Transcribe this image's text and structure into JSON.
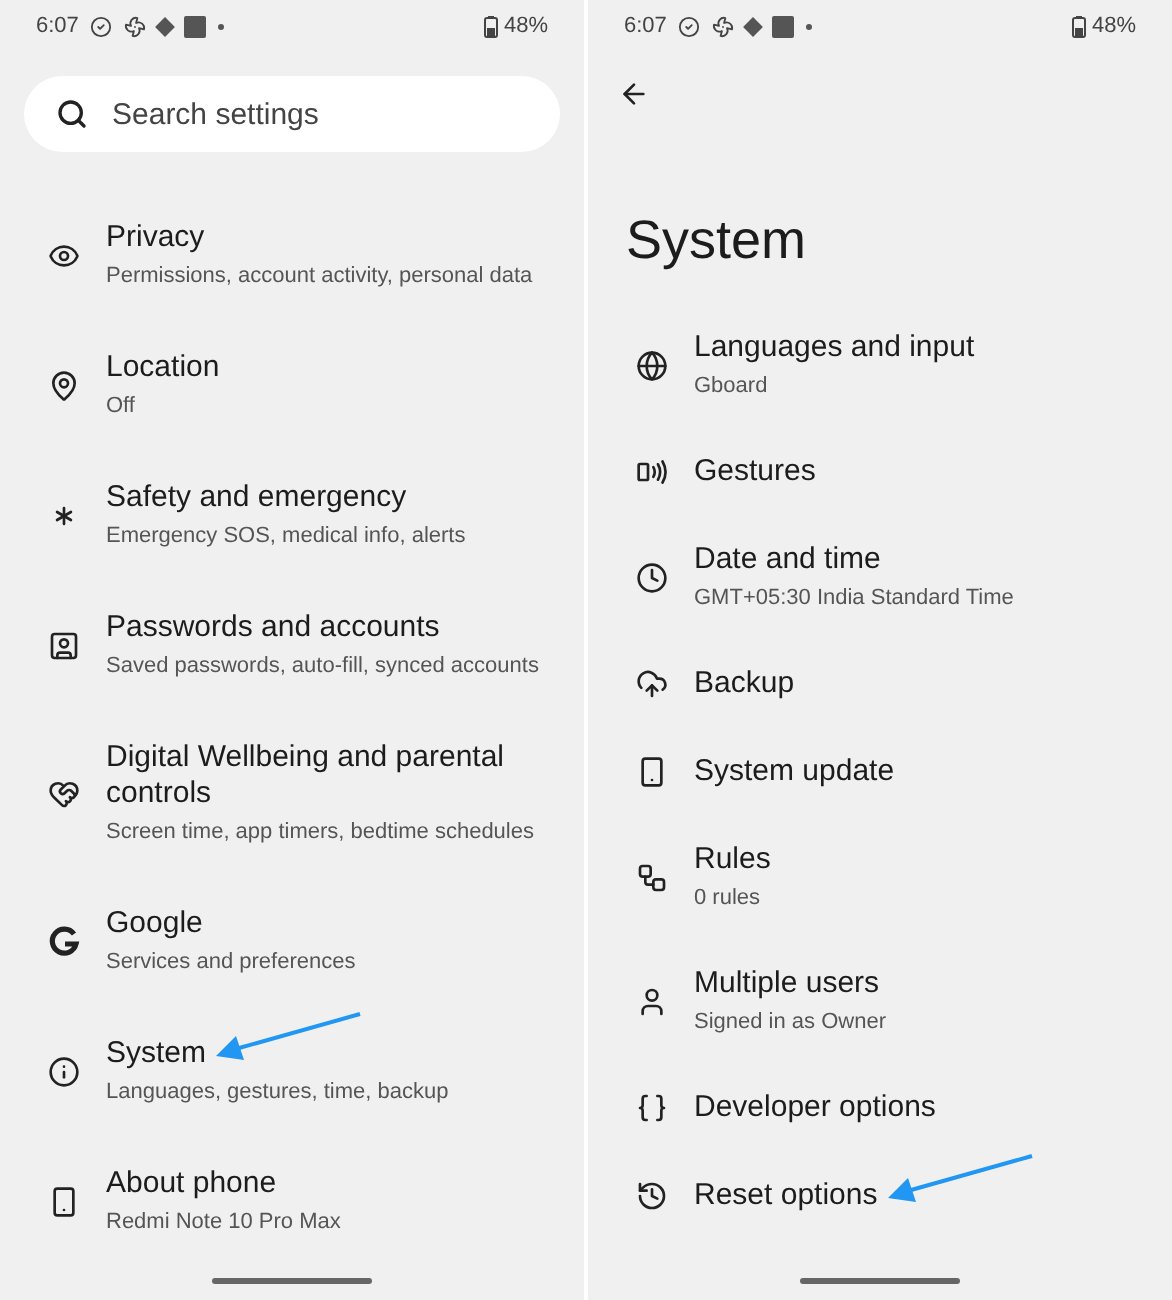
{
  "screens": [
    {
      "status_bar": {
        "time": "6:07",
        "battery": "48%"
      },
      "search": {
        "placeholder": "Search settings"
      },
      "items": [
        {
          "title": "Privacy",
          "subtitle": "Permissions, account activity, personal data",
          "annotated": false
        },
        {
          "title": "Location",
          "subtitle": "Off",
          "annotated": false
        },
        {
          "title": "Safety and emergency",
          "subtitle": "Emergency SOS, medical info, alerts",
          "annotated": false
        },
        {
          "title": "Passwords and accounts",
          "subtitle": "Saved passwords, auto-fill, synced accounts",
          "annotated": false
        },
        {
          "title": "Digital Wellbeing and parental controls",
          "subtitle": "Screen time, app timers, bedtime schedules",
          "annotated": false
        },
        {
          "title": "Google",
          "subtitle": "Services and preferences",
          "annotated": false
        },
        {
          "title": "System",
          "subtitle": "Languages, gestures, time, backup",
          "annotated": true
        },
        {
          "title": "About phone",
          "subtitle": "Redmi Note 10 Pro Max",
          "annotated": false
        }
      ]
    },
    {
      "status_bar": {
        "time": "6:07",
        "battery": "48%"
      },
      "title": "System",
      "items": [
        {
          "title": "Languages and input",
          "subtitle": "Gboard",
          "annotated": false
        },
        {
          "title": "Gestures",
          "annotated": false
        },
        {
          "title": "Date and time",
          "subtitle": "GMT+05:30 India Standard Time",
          "annotated": false
        },
        {
          "title": "Backup",
          "annotated": false
        },
        {
          "title": "System update",
          "annotated": false
        },
        {
          "title": "Rules",
          "subtitle": "0 rules",
          "annotated": false
        },
        {
          "title": "Multiple users",
          "subtitle": "Signed in as Owner",
          "annotated": false
        },
        {
          "title": "Developer options",
          "annotated": false
        },
        {
          "title": "Reset options",
          "annotated": true
        }
      ]
    }
  ]
}
